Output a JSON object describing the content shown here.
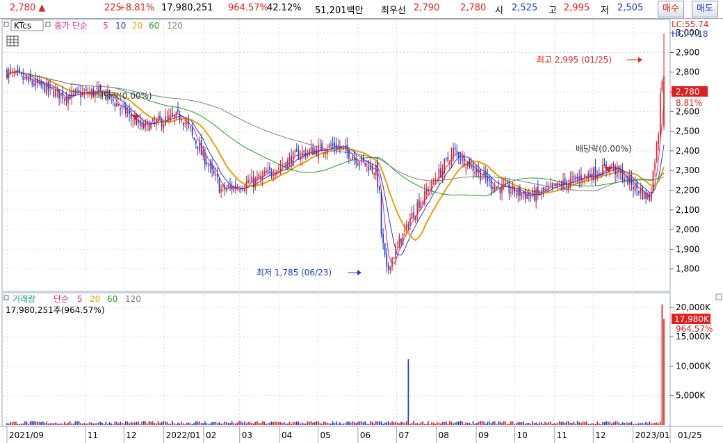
{
  "topbar": {
    "price": "2,780",
    "arrow": "▲",
    "change": "225",
    "change_pct": "+8.81%",
    "volume": "17,980,251",
    "volume_ratio": "964.57%",
    "turnover": "42.12%",
    "amount": "51,201백만",
    "best_label": "최우선",
    "best_ask": "2,790",
    "best_bid": "2,780",
    "open_label": "시",
    "open": "2,525",
    "high_label": "고",
    "high": "2,995",
    "low_label": "저",
    "low": "2,505",
    "buy_button": "매수",
    "sell_button": "매도"
  },
  "price_panel": {
    "legend_code": "KTcs",
    "legend_ma_label": "종가 단순",
    "ma_periods": [
      "5",
      "10",
      "20",
      "60",
      "120"
    ],
    "lc_label": "LC:55.74",
    "hc_label": "HC:-7.18",
    "current_tag": "2,780",
    "current_pct_tag": "8.81%",
    "high_annotation": "최고 2,995 (01/25)",
    "low_annotation": "최저 1,785 (06/23)",
    "dividend_label_1": "배당락(0.00%)",
    "dividend_label_2": "배당락(0.00%)"
  },
  "volume_panel": {
    "legend_title": "거래량",
    "legend_ma_label": "단순",
    "ma_periods": [
      "5",
      "20",
      "60",
      "120"
    ],
    "value_label": "17,980,251주(964.57%)",
    "current_tag": "17,980K",
    "current_pct_tag": "964.57%"
  },
  "x_axis": {
    "labels": [
      "2021/09",
      "11",
      "12",
      "2022/01",
      "02",
      "03",
      "04",
      "05",
      "06",
      "07",
      "08",
      "09",
      "10",
      "11",
      "12",
      "2023/01"
    ],
    "right_label": "01/25"
  },
  "colors": {
    "up": "#e0201c",
    "down": "#1e3cd0",
    "ma5": "#e0209a",
    "ma10": "#1e3cd0",
    "ma20": "#e8a000",
    "ma60": "#1f9a2a",
    "ma120": "#808080"
  },
  "chart_data": [
    {
      "type": "candlestick",
      "title": "KTcs",
      "x_range": [
        "2021/09",
        "2023/01/25"
      ],
      "ylim": [
        1700,
        3050
      ],
      "y_ticks": [
        1800,
        1900,
        2000,
        2100,
        2200,
        2300,
        2400,
        2500,
        2600,
        2700,
        2800,
        2900,
        3000
      ],
      "y_tick_labels": [
        "1,800",
        "1,900",
        "2,000",
        "2,100",
        "2,200",
        "2,300",
        "2,400",
        "2,500",
        "2,600",
        "2,700",
        "2,800",
        "2,900",
        "3,000"
      ],
      "grid": true,
      "approx_close_path": [
        [
          "2021/09",
          2800
        ],
        [
          "2021/10",
          2680
        ],
        [
          "2021/11",
          2700
        ],
        [
          "2021/12",
          2520
        ],
        [
          "2022/01",
          2580
        ],
        [
          "2022/02",
          2200
        ],
        [
          "2022/03",
          2250
        ],
        [
          "2022/04",
          2380
        ],
        [
          "2022/05",
          2430
        ],
        [
          "2022/06",
          2300
        ],
        [
          "2022/06/23",
          1785
        ],
        [
          "2022/07",
          2100
        ],
        [
          "2022/08",
          2400
        ],
        [
          "2022/09",
          2220
        ],
        [
          "2022/10",
          2170
        ],
        [
          "2022/11",
          2250
        ],
        [
          "2022/12",
          2320
        ],
        [
          "2023/01",
          2150
        ],
        [
          "2023/01/25",
          2780
        ]
      ],
      "last": {
        "open": 2525,
        "high": 2995,
        "low": 2505,
        "close": 2780
      }
    },
    {
      "type": "bar",
      "title": "거래량",
      "ylim": [
        0,
        22000
      ],
      "y_ticks": [
        5000,
        10000,
        15000,
        20000
      ],
      "y_tick_labels": [
        "5,000K",
        "10,000K",
        "15,000K",
        "20,000K"
      ],
      "spikes": [
        {
          "x": "2022/07",
          "value": 11200
        },
        {
          "x": "2023/01/24",
          "value": 20500
        },
        {
          "x": "2023/01/25",
          "value": 17980
        }
      ],
      "typical_value": 400
    }
  ]
}
